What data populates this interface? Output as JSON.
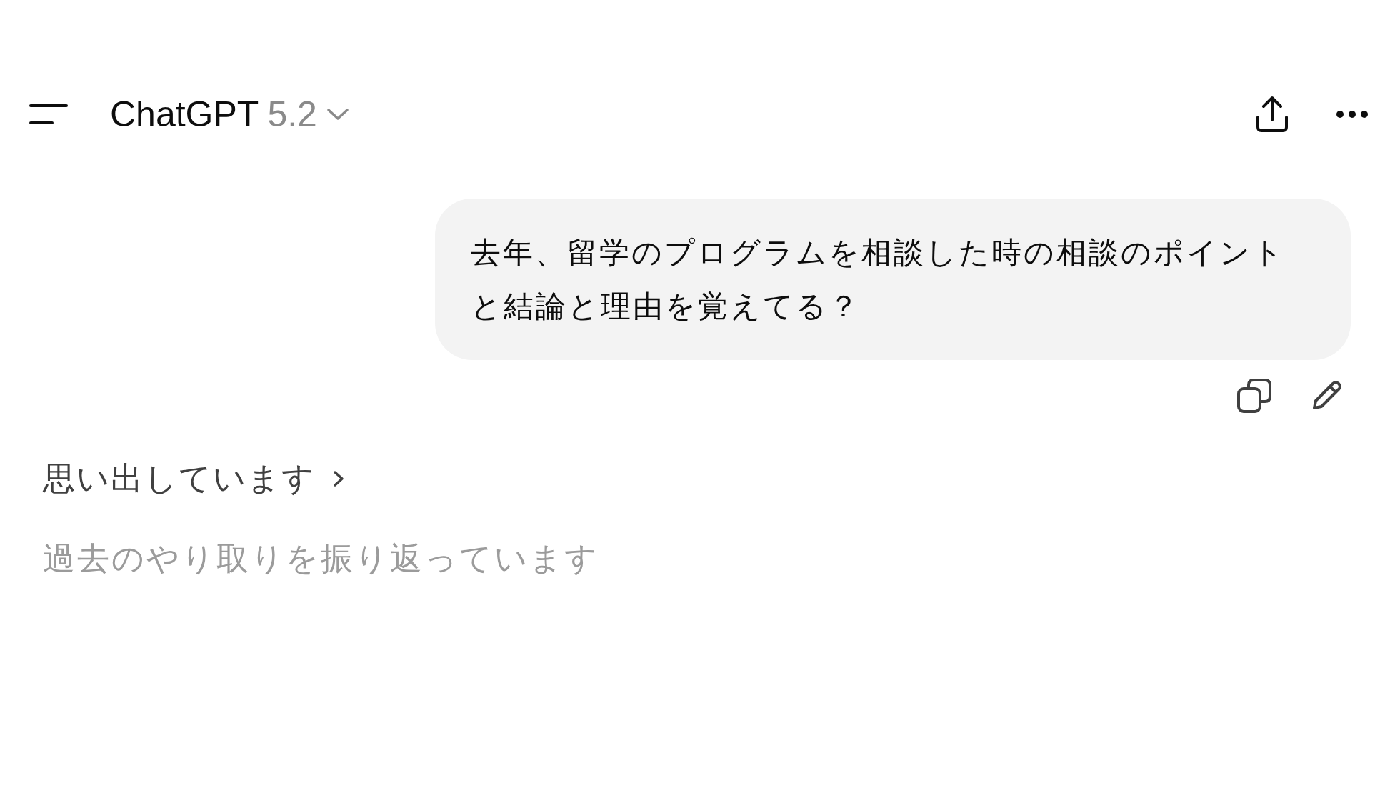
{
  "header": {
    "title": "ChatGPT",
    "version": "5.2"
  },
  "messages": [
    {
      "text": "去年、留学のプログラムを相談した時の相談のポイントと結論と理由を覚えてる？"
    }
  ],
  "thinking": {
    "label": "思い出しています",
    "expanded": false,
    "status": "過去のやり取りを振り返っています"
  }
}
